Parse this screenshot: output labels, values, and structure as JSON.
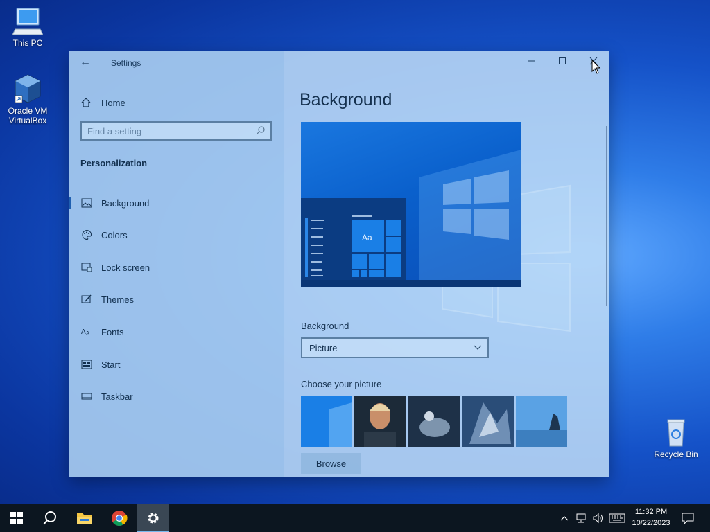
{
  "desktop": {
    "icons": [
      {
        "label": "This PC"
      },
      {
        "label": "Oracle VM VirtualBox"
      },
      {
        "label": "Recycle Bin"
      }
    ]
  },
  "window": {
    "title": "Settings",
    "controls": {
      "minimize": "minimize-icon",
      "maximize": "maximize-icon",
      "close": "close-icon"
    }
  },
  "sidebar": {
    "home_label": "Home",
    "search_placeholder": "Find a setting",
    "section_title": "Personalization",
    "items": [
      {
        "label": "Background",
        "icon": "picture-icon",
        "selected": true
      },
      {
        "label": "Colors",
        "icon": "palette-icon",
        "selected": false
      },
      {
        "label": "Lock screen",
        "icon": "lock-screen-icon",
        "selected": false
      },
      {
        "label": "Themes",
        "icon": "themes-icon",
        "selected": false
      },
      {
        "label": "Fonts",
        "icon": "fonts-icon",
        "selected": false
      },
      {
        "label": "Start",
        "icon": "start-icon",
        "selected": false
      },
      {
        "label": "Taskbar",
        "icon": "taskbar-icon",
        "selected": false
      }
    ]
  },
  "main": {
    "title": "Background",
    "preview_text": "Aa",
    "background_label": "Background",
    "background_value": "Picture",
    "choose_label": "Choose your picture",
    "browse_label": "Browse"
  },
  "taskbar": {
    "pinned": [
      "start-icon",
      "search-icon",
      "file-explorer-icon",
      "chrome-icon",
      "settings-icon"
    ],
    "tray": [
      "chevron-up-icon",
      "network-icon",
      "volume-icon",
      "keyboard-icon",
      "notifications-icon"
    ],
    "time": "11:32 PM",
    "date": "10/22/2023"
  },
  "colors": {
    "accent": "#0a60cc",
    "taskbar": "#0c1620",
    "active_app": "#3a4754"
  }
}
